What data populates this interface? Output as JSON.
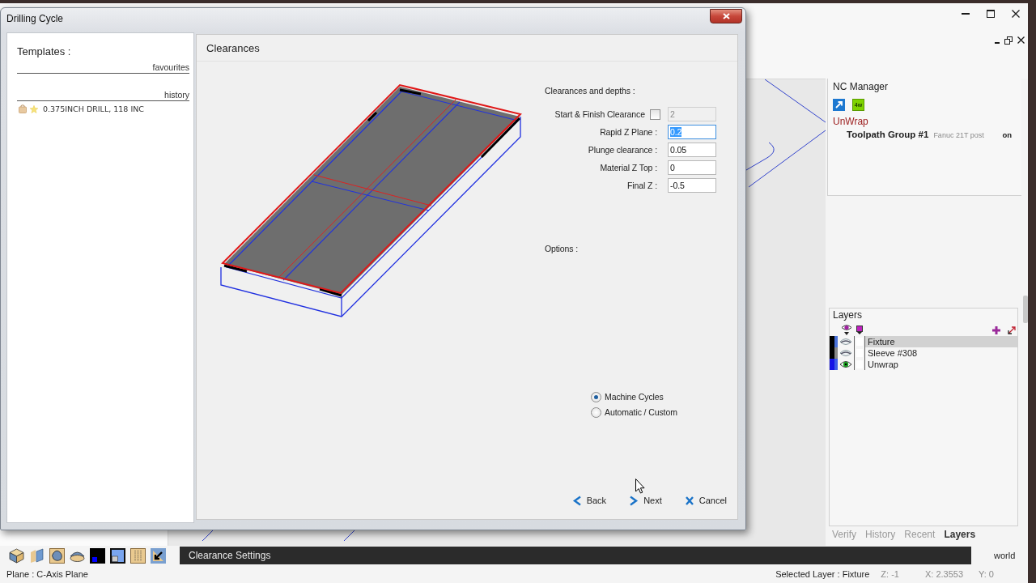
{
  "dialog": {
    "title": "Drilling Cycle",
    "templates": {
      "heading": "Templates :",
      "favourites_label": "favourites",
      "history_label": "history",
      "history_items": [
        {
          "text": "0.375INCH DRILL, 118 INC",
          "favourite": true
        }
      ]
    },
    "page": {
      "title": "Clearances",
      "depths_heading": "Clearances and depths :",
      "fields": [
        {
          "kind": "checkbox",
          "label": "Start & Finish Clearance",
          "checked": false,
          "value": "2",
          "disabled": true,
          "focused": false
        },
        {
          "kind": "field",
          "label": "Rapid Z Plane :",
          "value": "0.2",
          "disabled": false,
          "focused": true
        },
        {
          "kind": "field",
          "label": "Plunge clearance :",
          "value": "0.05",
          "disabled": false,
          "focused": false
        },
        {
          "kind": "field",
          "label": "Material Z Top :",
          "value": "0",
          "disabled": false,
          "focused": false
        },
        {
          "kind": "field",
          "label": "Final Z :",
          "value": "-0.5",
          "disabled": false,
          "focused": false
        }
      ],
      "options_heading": "Options :",
      "cycle_types": [
        {
          "label": "Machine Cycles",
          "selected": true
        },
        {
          "label": "Automatic / Custom",
          "selected": false
        }
      ],
      "buttons": [
        {
          "kind": "back",
          "label": "Back"
        },
        {
          "kind": "next",
          "label": "Next"
        },
        {
          "kind": "cancel",
          "label": "Cancel"
        }
      ]
    }
  },
  "nc_manager": {
    "title": "NC Manager",
    "badge_label": "4w",
    "machine": "UnWrap",
    "groups": [
      {
        "name": "Toolpath Group #1",
        "post": "Fanuc 21T post",
        "state": "on"
      }
    ]
  },
  "layers": {
    "title": "Layers",
    "rows": [
      {
        "name": "Fixture",
        "selected": true,
        "visible": false,
        "swatches": [
          {
            "color": "#000000"
          },
          {
            "color": "#4a72d8"
          }
        ]
      },
      {
        "name": "Sleeve #308",
        "selected": false,
        "visible": false,
        "swatches": [
          {
            "color": "#000000"
          },
          {
            "color": "#888888"
          }
        ]
      },
      {
        "name": "Unwrap",
        "selected": false,
        "visible": true,
        "swatches": [
          {
            "color": "#1414e6"
          },
          {
            "color": "#3d5ee8"
          }
        ]
      }
    ]
  },
  "panel_tabs": [
    {
      "label": "Verify",
      "selected": false
    },
    {
      "label": "History",
      "selected": false
    },
    {
      "label": "Recent",
      "selected": false
    },
    {
      "label": "Layers",
      "selected": true
    }
  ],
  "command_bar": {
    "prompt": "Clearance Settings",
    "mode": "world"
  },
  "status_bar": {
    "plane": "Plane : C-Axis Plane",
    "selected_layer": "Selected Layer : Fixture",
    "z": "Z: -1",
    "x": "X: 2.3553",
    "y": "Y: 0"
  }
}
